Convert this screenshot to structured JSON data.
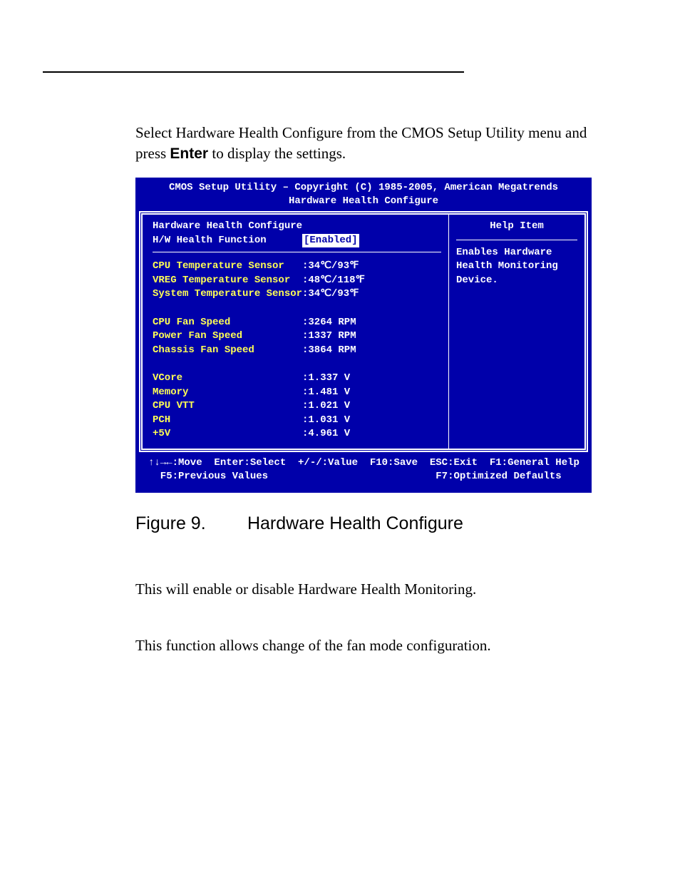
{
  "intro": {
    "line1_pre": "Select Hardware Health Configure from the CMOS Setup Utility menu and press ",
    "enter_bold": "Enter",
    "line1_post": " to display the settings."
  },
  "bios": {
    "title1": "CMOS Setup Utility – Copyright (C) 1985-2005, American Megatrends",
    "title2": "Hardware Health Configure",
    "heading_label": "Hardware Health Configure",
    "hw_label": "H/W Health Function",
    "hw_value": "[Enabled]",
    "help_title": "Help Item",
    "help_text1": "Enables Hardware",
    "help_text2": "Health Monitoring",
    "help_text3": "Device.",
    "rows": [
      {
        "label": "CPU Temperature Sensor",
        "value": ":34℃/93℉"
      },
      {
        "label": "VREG Temperature Sensor",
        "value": ":48℃/118℉"
      },
      {
        "label": "System Temperature Sensor",
        "value": ":34℃/93℉"
      },
      {
        "label": "",
        "value": ""
      },
      {
        "label": "CPU Fan Speed",
        "value": ":3264 RPM"
      },
      {
        "label": "Power Fan Speed",
        "value": ":1337 RPM"
      },
      {
        "label": "Chassis Fan Speed",
        "value": ":3864 RPM"
      },
      {
        "label": "",
        "value": ""
      },
      {
        "label": "VCore",
        "value": ":1.337 V"
      },
      {
        "label": "Memory",
        "value": ":1.481 V"
      },
      {
        "label": "CPU VTT",
        "value": ":1.021 V"
      },
      {
        "label": "PCH",
        "value": ":1.031 V"
      },
      {
        "label": "+5V",
        "value": ":4.961 V"
      }
    ],
    "chart_data": {
      "type": "table",
      "title": "Hardware Health Configure readings",
      "categories": [
        "CPU Temperature Sensor",
        "VREG Temperature Sensor",
        "System Temperature Sensor",
        "CPU Fan Speed",
        "Power Fan Speed",
        "Chassis Fan Speed",
        "VCore",
        "Memory",
        "CPU VTT",
        "PCH",
        "+5V"
      ],
      "values": [
        "34℃/93℉",
        "48℃/118℉",
        "34℃/93℉",
        "3264 RPM",
        "1337 RPM",
        "3864 RPM",
        "1.337 V",
        "1.481 V",
        "1.021 V",
        "1.031 V",
        "4.961 V"
      ]
    },
    "footer1": "↑↓→←:Move  Enter:Select  +/-/:Value  F10:Save  ESC:Exit  F1:General Help",
    "footer2": "  F5:Previous Values                            F7:Optimized Defaults"
  },
  "figure": {
    "num": "Figure 9.",
    "cap": "Hardware Health Configure"
  },
  "sections": {
    "s1": "This will enable or disable Hardware Health Monitoring.",
    "s2": "This function allows change of the fan mode configuration."
  }
}
